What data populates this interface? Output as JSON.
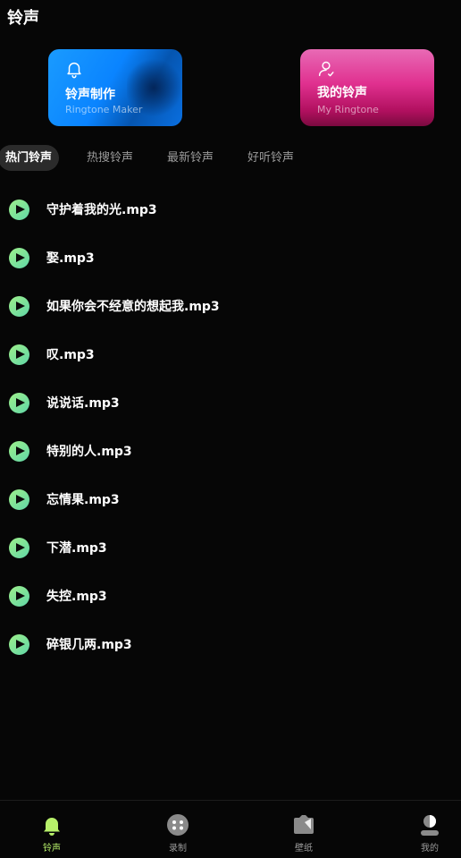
{
  "header": {
    "title": "铃声"
  },
  "cards": [
    {
      "title": "铃声制作",
      "subtitle": "Ringtone Maker",
      "icon": "bell-icon"
    },
    {
      "title": "我的铃声",
      "subtitle": "My Ringtone",
      "icon": "user-icon"
    }
  ],
  "tabs": [
    {
      "label": "热门铃声",
      "active": true
    },
    {
      "label": "热搜铃声",
      "active": false
    },
    {
      "label": "最新铃声",
      "active": false
    },
    {
      "label": "好听铃声",
      "active": false
    }
  ],
  "songs": [
    "守护着我的光.mp3",
    "娶.mp3",
    "如果你会不经意的想起我.mp3",
    "叹.mp3",
    "说说话.mp3",
    "特别的人.mp3",
    "忘情果.mp3",
    "下潜.mp3",
    "失控.mp3",
    "碎银几两.mp3"
  ],
  "nav": [
    {
      "label": "铃声",
      "icon": "bell-icon",
      "active": true
    },
    {
      "label": "录制",
      "icon": "record-icon",
      "active": false
    },
    {
      "label": "壁纸",
      "icon": "wallpaper-icon",
      "active": false
    },
    {
      "label": "我的",
      "icon": "profile-icon",
      "active": false
    }
  ],
  "colors": {
    "accent": "#b7f06a",
    "background": "#060606",
    "maker_card": "#0a84ff",
    "mine_card": "#e0308f"
  }
}
